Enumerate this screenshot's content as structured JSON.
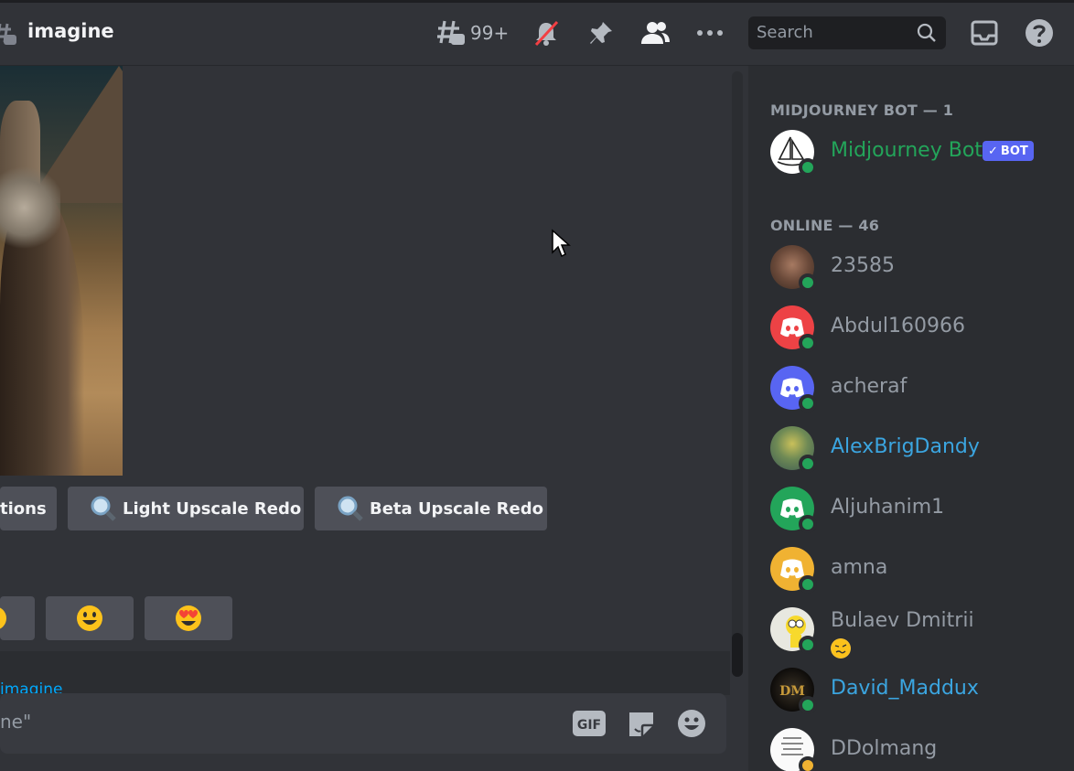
{
  "header": {
    "channel_name": "imagine",
    "threads_count": "99+",
    "search_placeholder": "Search"
  },
  "message": {
    "buttons": [
      {
        "label": "tions"
      },
      {
        "label": "Light Upscale Redo"
      },
      {
        "label": "Beta Upscale Redo"
      }
    ],
    "reactions": [
      "😐",
      "😀",
      "😍"
    ]
  },
  "composer": {
    "reply_reference": "imagine",
    "placeholder": "ne\""
  },
  "members": {
    "sections": [
      {
        "title": "MIDJOURNEY BOT — 1"
      },
      {
        "title": "ONLINE — 46"
      }
    ],
    "bot": {
      "name": "Midjourney Bot",
      "tag": "BOT",
      "color": "#23a55a"
    },
    "list": [
      {
        "name": "23585",
        "color": "#949ba4",
        "avatar": "photo-avatar"
      },
      {
        "name": "Abdul160966",
        "color": "#949ba4",
        "avatar": "discord-red"
      },
      {
        "name": "acheraf",
        "color": "#949ba4",
        "avatar": "discord-blurple"
      },
      {
        "name": "AlexBrigDandy",
        "color": "#3ba5e0",
        "avatar": "photo-avatar"
      },
      {
        "name": "Aljuhanim1",
        "color": "#949ba4",
        "avatar": "discord-green"
      },
      {
        "name": "amna",
        "color": "#949ba4",
        "avatar": "discord-yellow"
      },
      {
        "name": "Bulaev Dmitrii",
        "color": "#949ba4",
        "avatar": "cartoon-avatar",
        "custom_status_emoji": "🥴"
      },
      {
        "name": "David_Maddux",
        "color": "#3ba5e0",
        "avatar": "logo-avatar"
      },
      {
        "name": "DDolmang",
        "color": "#949ba4",
        "avatar": "text-avatar",
        "status": "idle"
      }
    ]
  }
}
